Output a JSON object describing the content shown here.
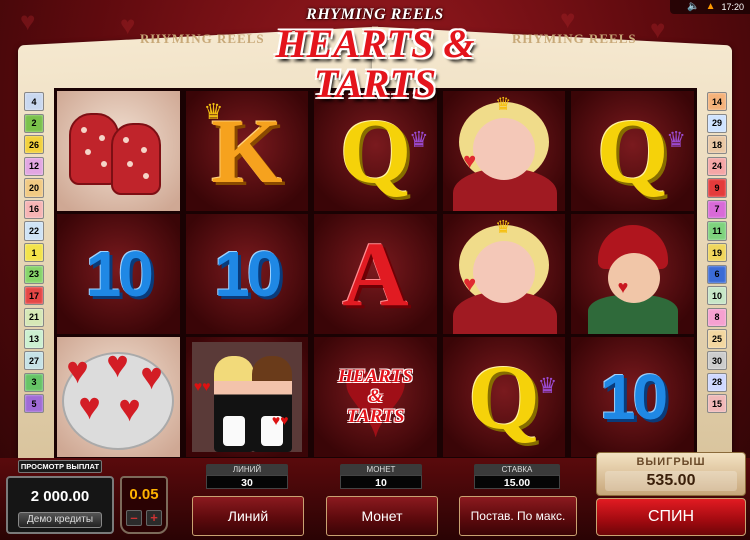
{
  "status": {
    "time": "17:20",
    "icons": [
      "speaker-icon",
      "fire-icon"
    ]
  },
  "logo": {
    "sub": "RHYMING REELS",
    "main": "HEARTS & TARTS",
    "page_text": "RHYMING REELS"
  },
  "lines": {
    "left": [
      {
        "n": "4",
        "color": "#c9d8ef"
      },
      {
        "n": "2",
        "color": "#7ac24b"
      },
      {
        "n": "26",
        "color": "#f2d13b"
      },
      {
        "n": "12",
        "color": "#e2a6e2"
      },
      {
        "n": "20",
        "color": "#f1ca83"
      },
      {
        "n": "16",
        "color": "#f6b4b4"
      },
      {
        "n": "22",
        "color": "#cfe3f5"
      },
      {
        "n": "1",
        "color": "#f3e34a"
      },
      {
        "n": "23",
        "color": "#86d46a"
      },
      {
        "n": "17",
        "color": "#e54646"
      },
      {
        "n": "21",
        "color": "#d6e8b6"
      },
      {
        "n": "13",
        "color": "#ccf0d0"
      },
      {
        "n": "27",
        "color": "#c6e2e6"
      },
      {
        "n": "3",
        "color": "#66c466"
      },
      {
        "n": "5",
        "color": "#9f6bd6"
      }
    ],
    "right": [
      {
        "n": "14",
        "color": "#f5b27a"
      },
      {
        "n": "29",
        "color": "#cfe3ff"
      },
      {
        "n": "18",
        "color": "#e9c7a4"
      },
      {
        "n": "24",
        "color": "#f4a6a6"
      },
      {
        "n": "9",
        "color": "#e43b3b"
      },
      {
        "n": "7",
        "color": "#d86ad8"
      },
      {
        "n": "11",
        "color": "#7ed37e"
      },
      {
        "n": "19",
        "color": "#f0d65c"
      },
      {
        "n": "6",
        "color": "#3b6bd6"
      },
      {
        "n": "10",
        "color": "#c7e6c7"
      },
      {
        "n": "8",
        "color": "#f6a0d0"
      },
      {
        "n": "25",
        "color": "#f3d7a0"
      },
      {
        "n": "30",
        "color": "#cccccc"
      },
      {
        "n": "28",
        "color": "#cfd8ff"
      },
      {
        "n": "15",
        "color": "#f0b8b8"
      }
    ]
  },
  "reels": [
    [
      "oven-mitts",
      "K",
      "10",
      "cookies"
    ],
    [
      "K",
      "10",
      "waitresses"
    ],
    [
      "Q",
      "A",
      "hearts-tarts-logo"
    ],
    [
      "queen",
      "queen",
      "Q"
    ],
    [
      "Q",
      "boy",
      "10"
    ]
  ],
  "symbols": {
    "hearts_tarts_line1": "HEARTS",
    "hearts_tarts_line2": "&",
    "hearts_tarts_line3": "TARTS"
  },
  "panel": {
    "paytable": "ПРОСМОТР ВЫПЛАТ",
    "credits_value": "2 000.00",
    "credits_label": "Демо кредиты",
    "coin_value": "0.05",
    "coin_minus": "–",
    "coin_plus": "+",
    "lines_title": "ЛИНИЙ",
    "lines_value": "30",
    "coins_title": "МОНЕТ",
    "coins_value": "10",
    "bet_title": "СТАВКА",
    "bet_value": "15.00",
    "lines_button": "Линий",
    "coins_button": "Монет",
    "maxbet_button": "Постав. По макс.",
    "win_title": "ВЫИГРЫШ",
    "win_value": "535.00",
    "spin_button": "СПИН"
  }
}
